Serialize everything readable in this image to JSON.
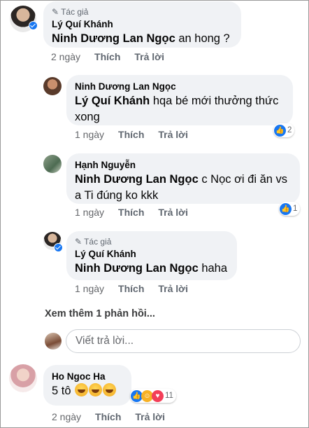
{
  "comments": [
    {
      "author": "Lý Quí Khánh",
      "author_tag": "Tác giả",
      "mention": "Ninh Dương Lan Ngọc",
      "text": " an hong ?",
      "time": "2 ngày",
      "like_label": "Thích",
      "reply_label": "Trả lời"
    },
    {
      "author": "Ninh Dương Lan Ngọc",
      "mention": "Lý Quí Khánh",
      "text_line1": "  hqa bé mới thưởng thức",
      "text_line2": "xong",
      "time": "1 ngày",
      "like_label": "Thích",
      "reply_label": "Trả lời",
      "reaction_count": "2"
    },
    {
      "author": "Hạnh Nguyễn",
      "mention": "Ninh Dương Lan Ngọc",
      "text_line1": " c Nọc ơi đi ăn vs",
      "text_line2": "a Ti đúng ko kkk",
      "time": "1 ngày",
      "like_label": "Thích",
      "reply_label": "Trả lời",
      "reaction_count": "1"
    },
    {
      "author": "Lý Quí Khánh",
      "author_tag": "Tác giả",
      "mention": "Ninh Dương Lan Ngọc",
      "text": " haha",
      "time": "1 ngày",
      "like_label": "Thích",
      "reply_label": "Trả lời"
    },
    {
      "author": "Ho Ngoc Ha",
      "text": "5 tô ",
      "time": "2 ngày",
      "like_label": "Thích",
      "reply_label": "Trả lời",
      "reaction_count": "11"
    }
  ],
  "more_replies": "Xem thêm 1 phản hồi...",
  "reply_input": {
    "placeholder": "Viết trả lời..."
  },
  "colors": {
    "accent": "#1877f2",
    "bubble": "#f0f2f5"
  }
}
